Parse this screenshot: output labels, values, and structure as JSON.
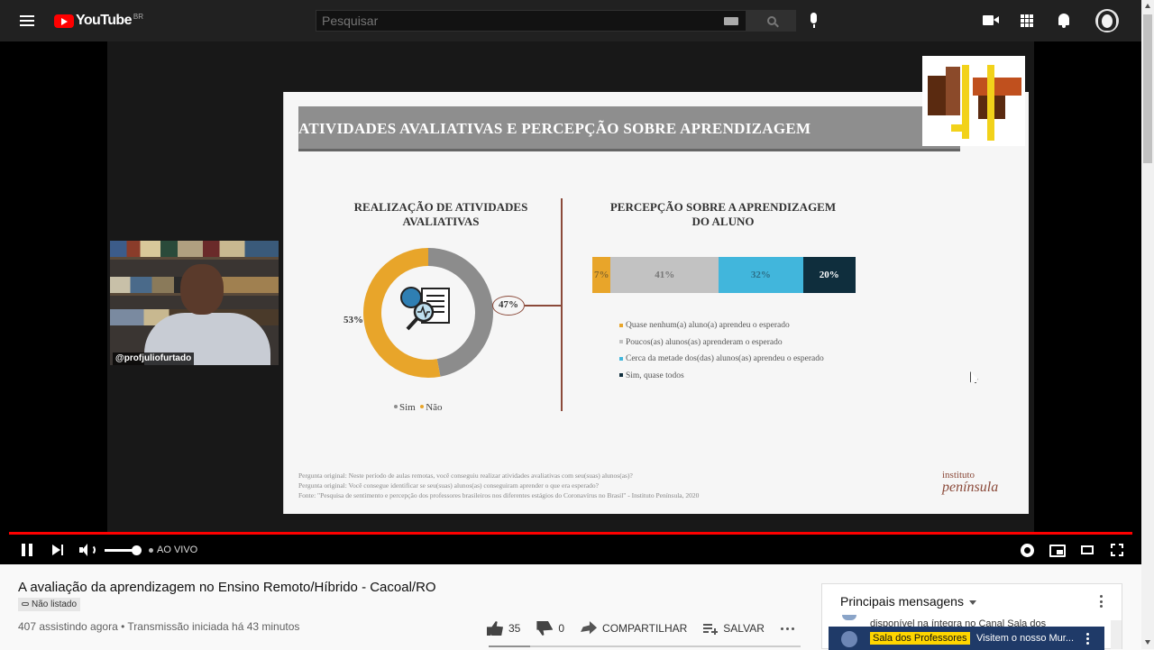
{
  "header": {
    "logo_text": "YouTube",
    "country_code": "BR",
    "search_placeholder": "Pesquisar"
  },
  "slide": {
    "title": "ATIVIDADES AVALIATIVAS E PERCEPÇÃO SOBRE APRENDIZAGEM",
    "left_title_1": "REALIZAÇÃO DE ATIVIDADES",
    "left_title_2": "AVALIATIVAS",
    "right_title_1": "PERCEPÇÃO SOBRE A APRENDIZAGEM",
    "right_title_2": "DO ALUNO",
    "footnote_1": "Pergunta original: Neste período de aulas remotas, você conseguiu realizar atividades avaliativas com seu(suas) alunos(as)?",
    "footnote_2": "Pergunta original: Você consegue identificar se seu(suas) alunos(as) conseguiram aprender o que era esperado?",
    "footnote_3": "Fonte: \"Pesquisa de sentimento e percepção dos professores brasileiros nos diferentes estágios do Coronavírus no Brasil\" - Instituto Península, 2020",
    "institute_line_1": "instituto",
    "institute_line_2": "península",
    "logo_colors": [
      "#5a2a10",
      "#8b4a2a",
      "#c0501e",
      "#f2d21a"
    ]
  },
  "chart_data": [
    {
      "type": "pie",
      "title": "REALIZAÇÃO DE ATIVIDADES AVALIATIVAS",
      "categories": [
        "Sim",
        "Não"
      ],
      "values": [
        47,
        53
      ],
      "value_labels": [
        "47%",
        "53%"
      ],
      "colors": [
        "#8c8c8c",
        "#e8a52a"
      ],
      "legend_placement": "bottom",
      "donut": true
    },
    {
      "type": "bar",
      "stacked": true,
      "orientation": "horizontal",
      "title": "PERCEPÇÃO SOBRE A APRENDIZAGEM DO ALUNO",
      "categories": [
        "Quase nenhum(a) aluno(a) aprendeu o esperado",
        "Poucos(as) alunos(as) aprenderam o esperado",
        "Cerca da metade dos(das) alunos(as) aprendeu o esperado",
        "Sim, quase todos"
      ],
      "values": [
        7,
        41,
        32,
        20
      ],
      "value_labels": [
        "7%",
        "41%",
        "32%",
        "20%"
      ],
      "colors": [
        "#e8a52a",
        "#c2c2c2",
        "#41b6dc",
        "#0f2e3d"
      ],
      "label_colors": [
        "#8a6a2a",
        "#777777",
        "#2c6f88",
        "#ffffff"
      ],
      "legend_placement": "bottom"
    }
  ],
  "webcam": {
    "tag": "@profjuliofurtado"
  },
  "player": {
    "live_label": "AO VIVO",
    "volume_level": 0.85,
    "progress_fraction": 1.0
  },
  "video": {
    "title": "A avaliação da aprendizagem no Ensino Remoto/Híbrido - Cacoal/RO",
    "visibility": "Não listado",
    "viewers": "407 assistindo agora",
    "separator": "•",
    "started": "Transmissão iniciada há 43 minutos",
    "likes": "35",
    "dislikes": "0",
    "share_label": "COMPARTILHAR",
    "save_label": "SALVAR"
  },
  "chat": {
    "header": "Principais mensagens",
    "partial_message": "disponível na íntegra no Canal Sala dos",
    "pinned_author": "Sala dos Professores",
    "pinned_text": "Visitem o nosso Mur..."
  }
}
